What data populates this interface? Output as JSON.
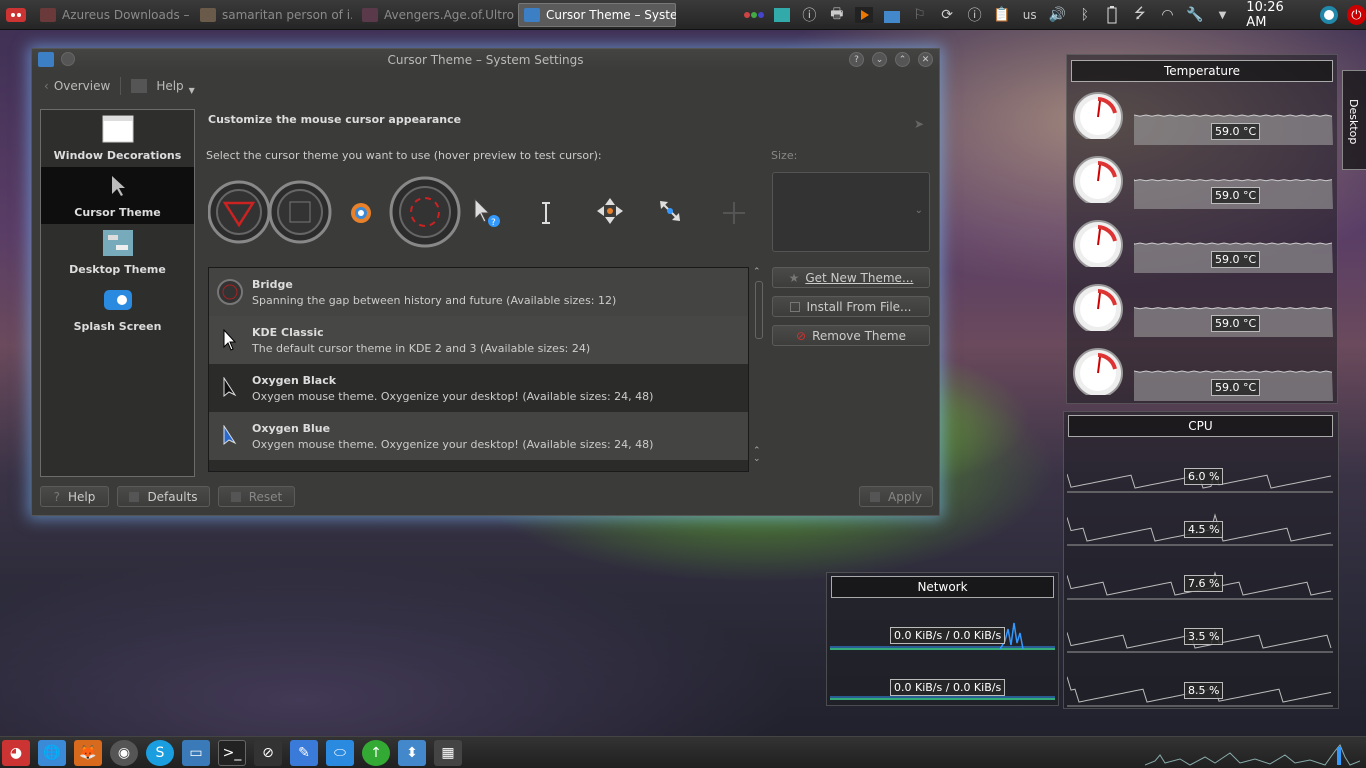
{
  "taskbar": {
    "tasks": [
      {
        "label": "Azureus Downloads – ..."
      },
      {
        "label": "samaritan person of i..."
      },
      {
        "label": "Avengers.Age.of.Ultron..."
      },
      {
        "label": "Cursor Theme – Syster"
      }
    ],
    "keyboard_layout": "us",
    "clock": "10:26 AM"
  },
  "dialog": {
    "title": "Cursor Theme – System Settings",
    "toolbar": {
      "overview": "Overview",
      "help": "Help"
    },
    "sidebar": [
      {
        "label": "Window Decorations"
      },
      {
        "label": "Cursor Theme"
      },
      {
        "label": "Desktop Theme"
      },
      {
        "label": "Splash Screen"
      }
    ],
    "heading": "Customize the mouse cursor appearance",
    "instruction": "Select the cursor theme you want to use (hover preview to test cursor):",
    "size_label": "Size:",
    "themes": [
      {
        "name": "Bridge",
        "description": "Spanning the gap between history and future (Available sizes: 12)"
      },
      {
        "name": "KDE Classic",
        "description": "The default cursor theme in KDE 2 and 3 (Available sizes: 24)"
      },
      {
        "name": "Oxygen Black",
        "description": "Oxygen mouse theme. Oxygenize your desktop! (Available sizes: 24, 48)"
      },
      {
        "name": "Oxygen Blue",
        "description": "Oxygen mouse theme. Oxygenize your desktop! (Available sizes: 24, 48)"
      }
    ],
    "side_buttons": {
      "get_new": "Get New Theme...",
      "install": "Install From File...",
      "remove": "Remove Theme"
    },
    "bottom_buttons": {
      "help": "Help",
      "defaults": "Defaults",
      "reset": "Reset",
      "apply": "Apply"
    }
  },
  "temperature": {
    "title": "Temperature",
    "readings": [
      "59.0 °C",
      "59.0 °C",
      "59.0 °C",
      "59.0 °C",
      "59.0 °C"
    ]
  },
  "cpu": {
    "title": "CPU",
    "readings": [
      "6.0 %",
      "4.5 %",
      "7.6 %",
      "3.5 %",
      "8.5 %"
    ]
  },
  "network": {
    "title": "Network",
    "readings": [
      "0.0 KiB/s / 0.0 KiB/s",
      "0.0 KiB/s / 0.0 KiB/s"
    ]
  },
  "desktop_tab": "Desktop",
  "colors": {
    "accent": "#7ac0ff",
    "power": "#cc0000"
  }
}
